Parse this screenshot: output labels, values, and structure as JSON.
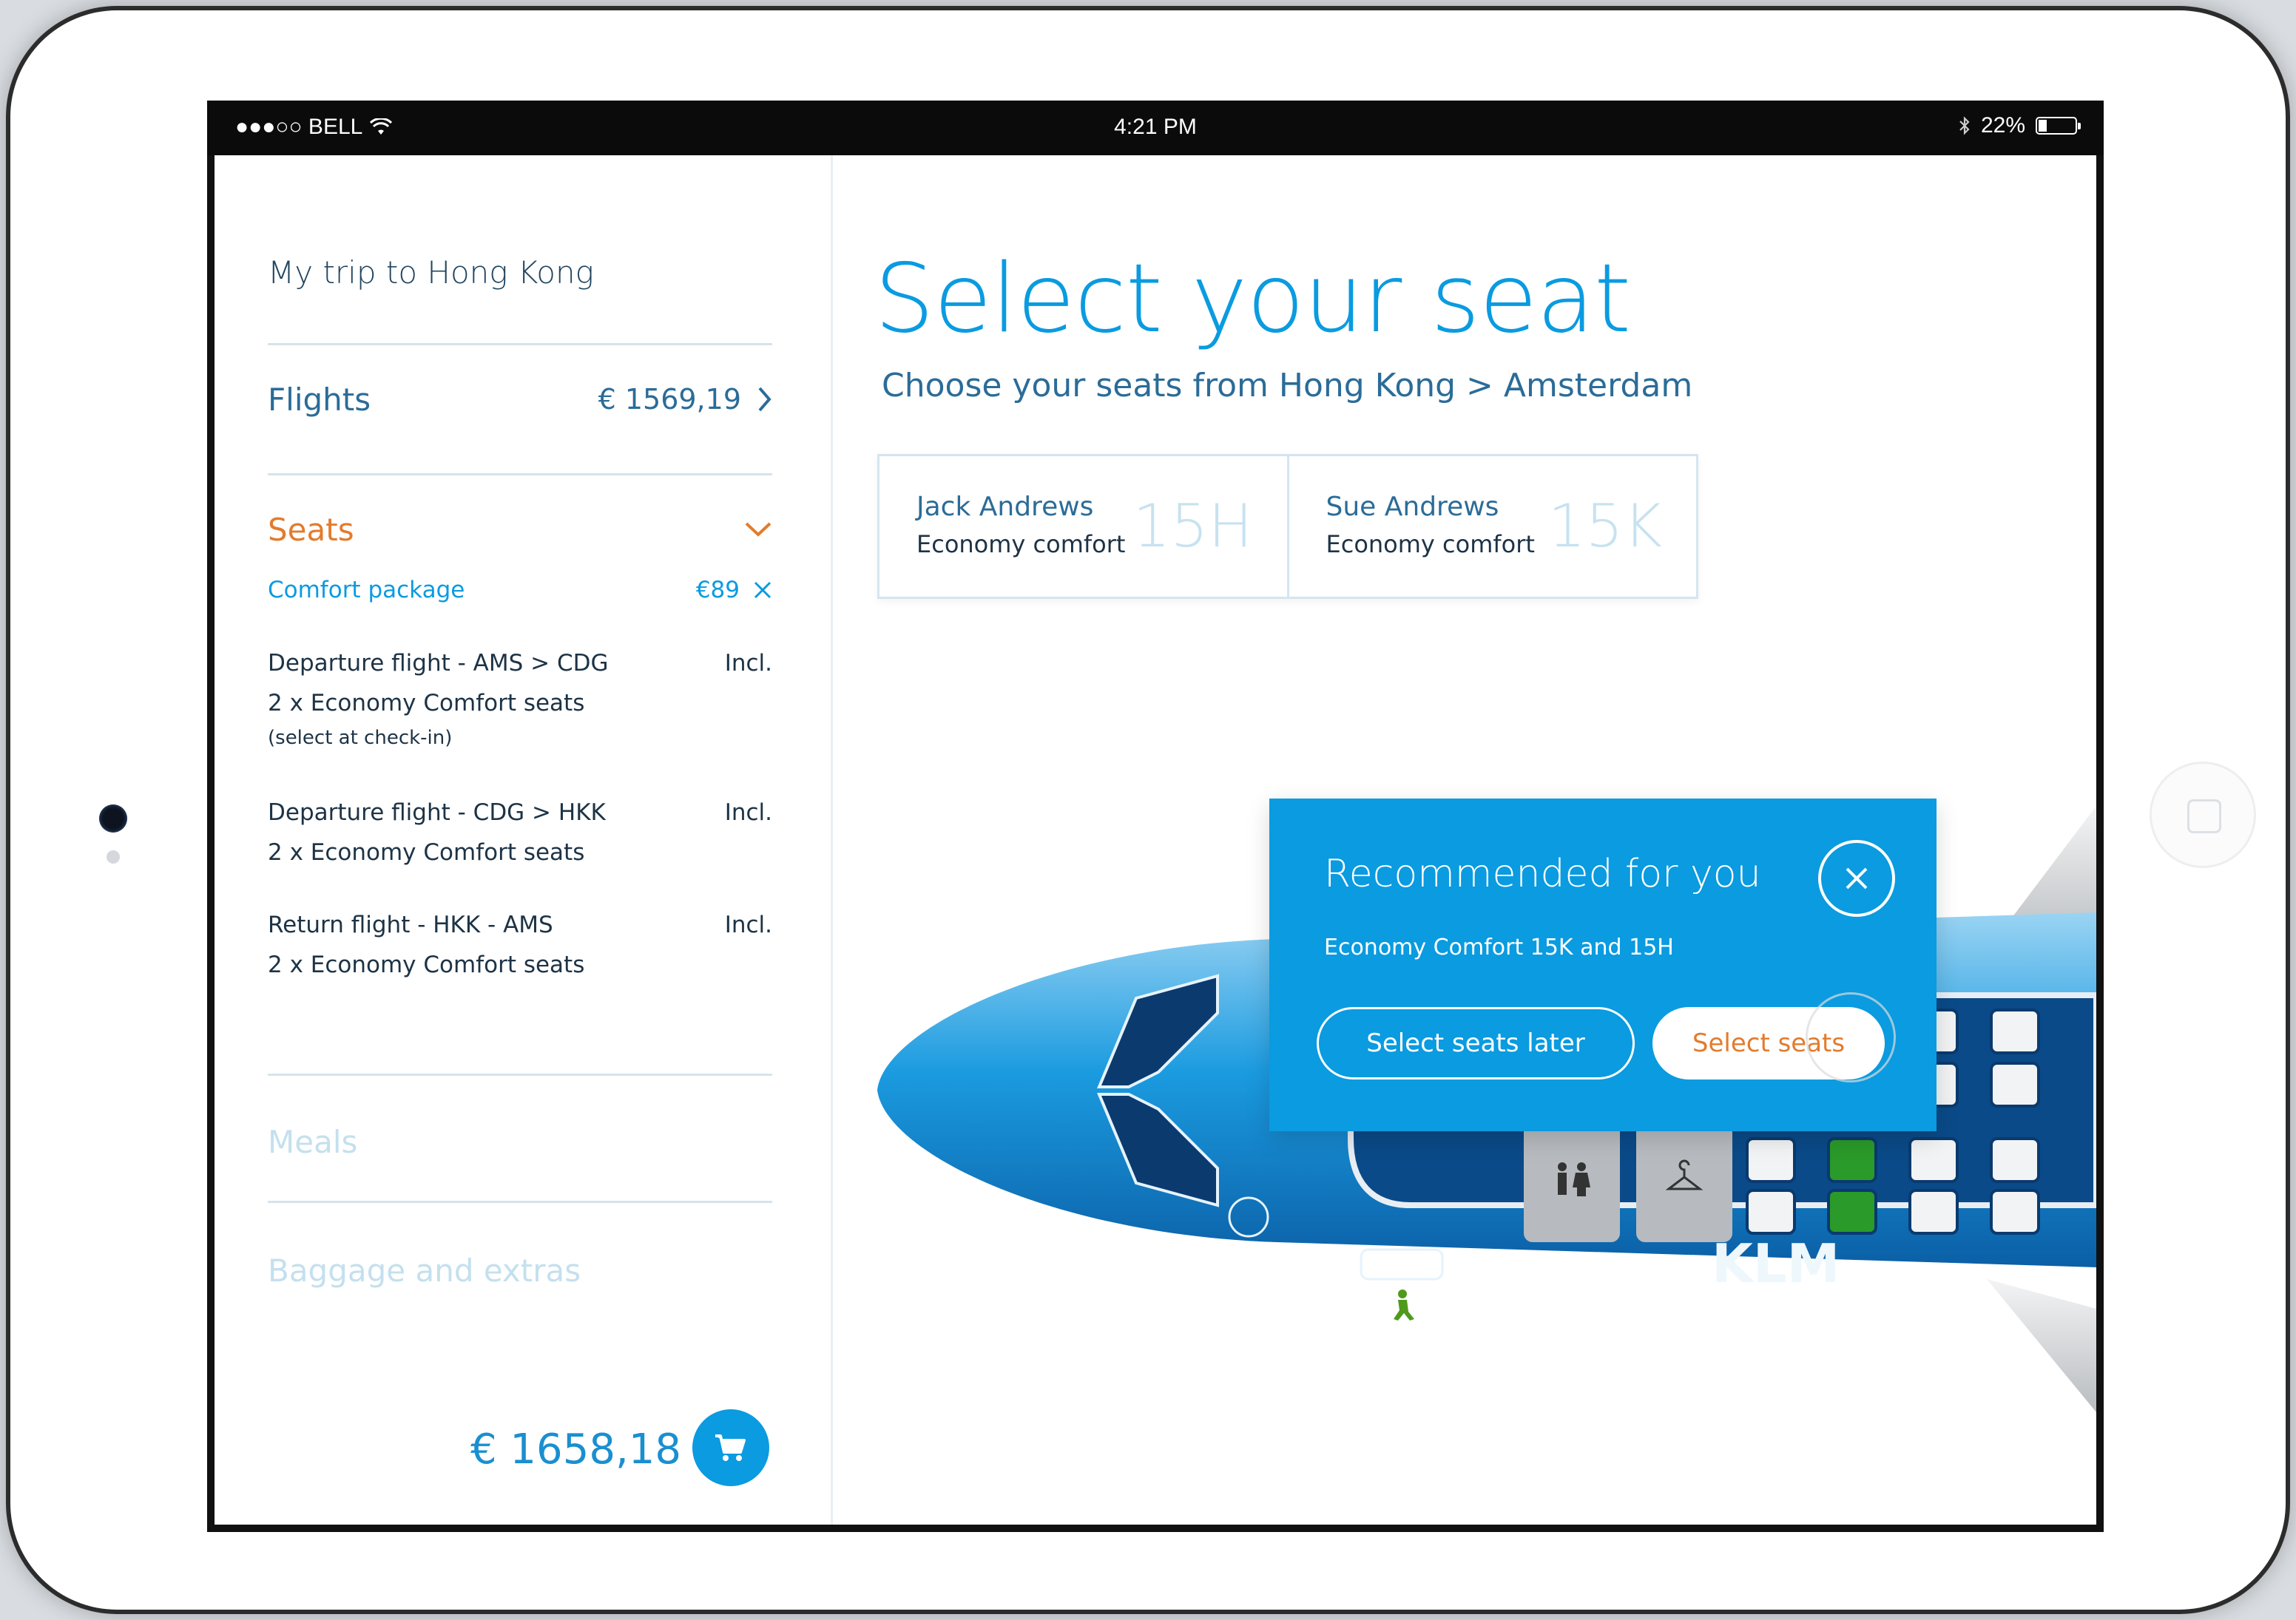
{
  "status_bar": {
    "carrier": "●●●○○ BELL",
    "time": "4:21 PM",
    "battery_text": "22%",
    "battery_level": 0.22
  },
  "sidebar": {
    "trip_title": "My trip to Hong Kong",
    "flights": {
      "label": "Flights",
      "price": "€ 1569,19"
    },
    "seats": {
      "label": "Seats",
      "comfort_label": "Comfort package",
      "comfort_price": "€89",
      "items": [
        {
          "title": "Departure flight - AMS > CDG",
          "status": "Incl.",
          "detail": "2 x Economy Comfort seats",
          "note": "(select at check-in)"
        },
        {
          "title": "Departure flight - CDG > HKK",
          "status": "Incl.",
          "detail": "2 x Economy Comfort seats",
          "note": ""
        },
        {
          "title": "Return flight - HKK - AMS",
          "status": "Incl.",
          "detail": "2 x Economy Comfort seats",
          "note": ""
        }
      ]
    },
    "meals_label": "Meals",
    "baggage_label": "Baggage and extras",
    "total": "€ 1658,18"
  },
  "main": {
    "title": "Select your seat",
    "subtitle": "Choose your seats from Hong Kong > Amsterdam",
    "passengers": [
      {
        "name": "Jack Andrews",
        "class": "Economy comfort",
        "seat": "15H"
      },
      {
        "name": "Sue Andrews",
        "class": "Economy comfort",
        "seat": "15K"
      }
    ],
    "airline_logo": "KLM",
    "recommend": {
      "title": "Recommended for you",
      "subtitle": "Economy Comfort 15K and 15H",
      "later_label": "Select seats later",
      "select_label": "Select seats"
    }
  },
  "colors": {
    "accent": "#0a9be0",
    "orange": "#e37b2d",
    "navy": "#1d3346",
    "selected_seat": "#2a9a2a"
  },
  "icons": [
    "wifi-icon",
    "bluetooth-icon",
    "battery-icon",
    "chevron-right-icon",
    "chevron-down-icon",
    "close-icon",
    "cart-icon",
    "restroom-icon",
    "hanger-icon",
    "exit-person-icon"
  ]
}
